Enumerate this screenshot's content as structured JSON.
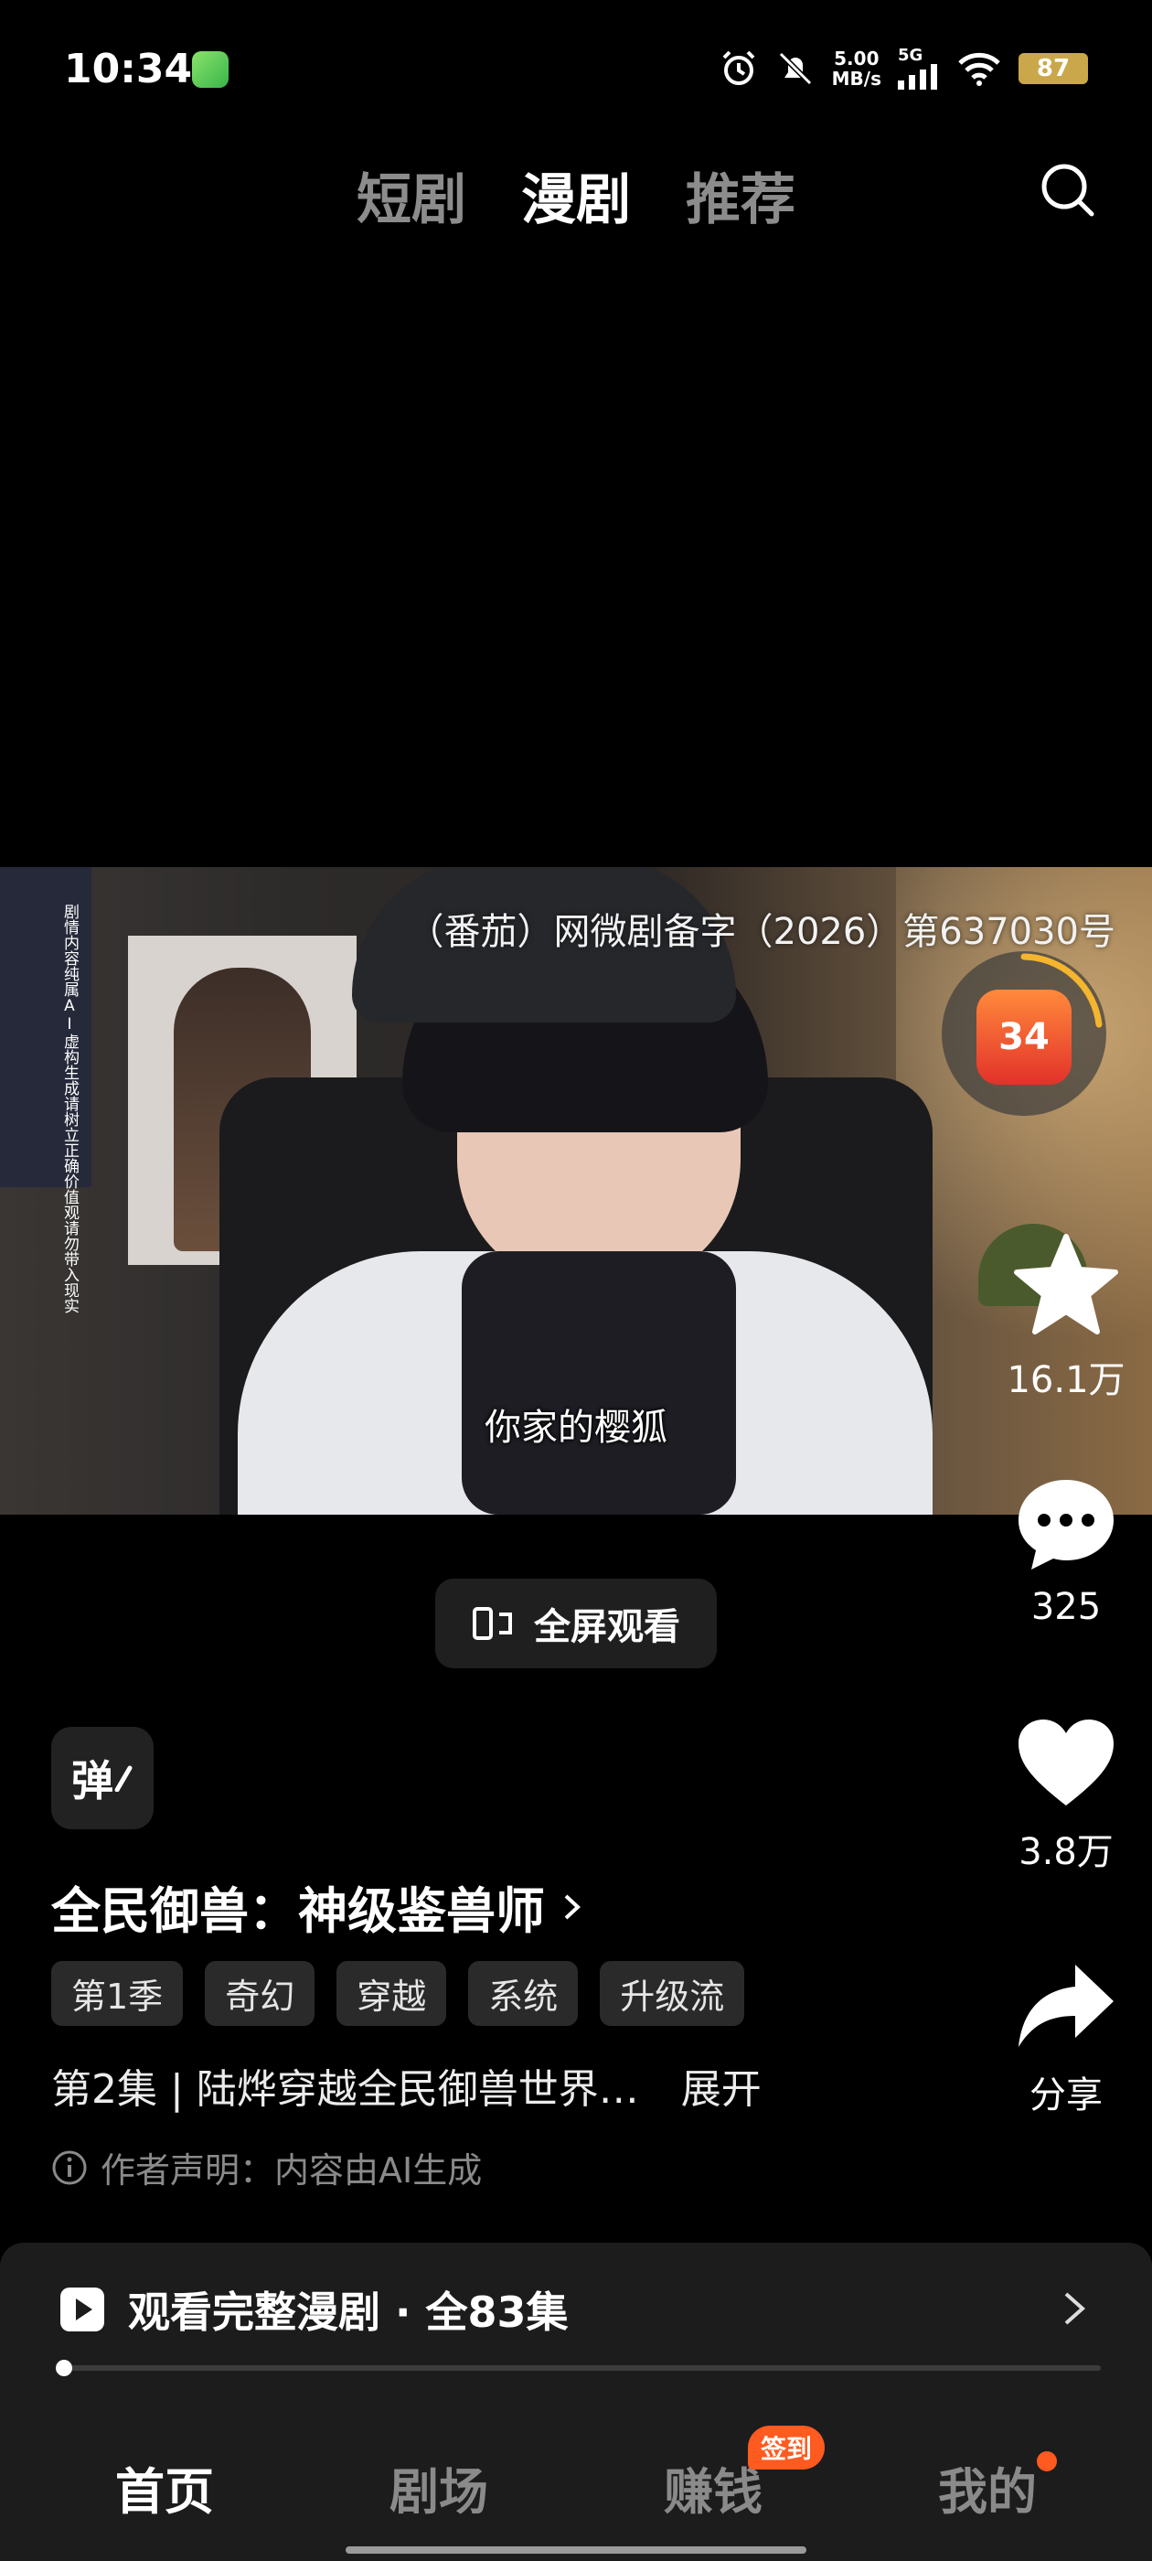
{
  "status_bar": {
    "time": "10:34",
    "speed_value": "5.00",
    "speed_unit": "MB/s",
    "network": "5G",
    "battery": "87"
  },
  "top_tabs": [
    {
      "label": "短剧",
      "active": false
    },
    {
      "label": "漫剧",
      "active": true
    },
    {
      "label": "推荐",
      "active": false
    }
  ],
  "video": {
    "license": "（番茄）网微剧备字（2026）第637030号",
    "disclaimer": "剧情内容纯属AI虚构生成请树立正确价值观请勿带入现实",
    "subtitle": "你家的樱狐"
  },
  "red_packet": {
    "text": "34"
  },
  "actions": {
    "collect_count": "16.1万",
    "comment_count": "325",
    "like_count": "3.8万",
    "share_label": "分享"
  },
  "fullscreen_label": "全屏观看",
  "danmaku_label": "弹",
  "drama": {
    "title": "全民御兽：神级鉴兽师",
    "tags": [
      "第1季",
      "奇幻",
      "穿越",
      "系统",
      "升级流"
    ],
    "description": "第2集 | 陆烨穿越全民御兽世界…",
    "expand_label": "展开",
    "notice": "作者声明：内容由AI生成"
  },
  "watch_full": {
    "label": "观看完整漫剧 · 全83集",
    "progress": 0.005
  },
  "bottom_nav": {
    "items": [
      {
        "label": "首页",
        "active": true
      },
      {
        "label": "剧场",
        "active": false
      },
      {
        "label": "赚钱",
        "active": false
      },
      {
        "label": "我的",
        "active": false
      }
    ],
    "earn_badge": "签到"
  },
  "colors": {
    "accent": "#ff5a1f",
    "background": "#000000"
  }
}
